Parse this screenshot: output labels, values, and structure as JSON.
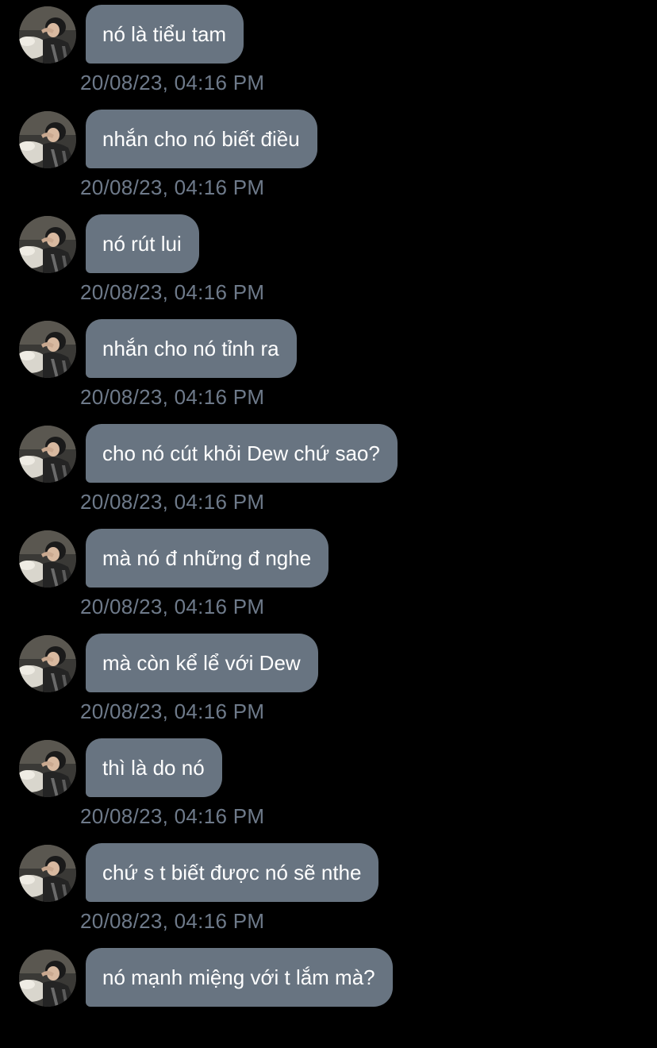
{
  "thread": {
    "messages": [
      {
        "text": "nó là tiểu tam",
        "time": "20/08/23, 04:16 PM"
      },
      {
        "text": "nhắn cho nó biết điều",
        "time": "20/08/23, 04:16 PM"
      },
      {
        "text": "nó rút lui",
        "time": "20/08/23, 04:16 PM"
      },
      {
        "text": "nhắn cho nó tỉnh ra",
        "time": "20/08/23, 04:16 PM"
      },
      {
        "text": "cho nó cút khỏi Dew chứ sao?",
        "time": "20/08/23, 04:16 PM"
      },
      {
        "text": "mà nó đ những đ nghe",
        "time": "20/08/23, 04:16 PM"
      },
      {
        "text": "mà còn kể lể với Dew",
        "time": "20/08/23, 04:16 PM"
      },
      {
        "text": "thì là do nó",
        "time": "20/08/23, 04:16 PM"
      },
      {
        "text": "chứ s t biết được nó sẽ nthe",
        "time": "20/08/23, 04:16 PM"
      },
      {
        "text": "nó mạnh miệng với t lắm mà?",
        "time": ""
      }
    ]
  },
  "colors": {
    "background": "#000000",
    "bubble": "#687481",
    "bubble_text": "#ffffff",
    "timestamp": "#6e7a8a"
  },
  "icons": {
    "avatar": "profile-photo-avatar"
  }
}
